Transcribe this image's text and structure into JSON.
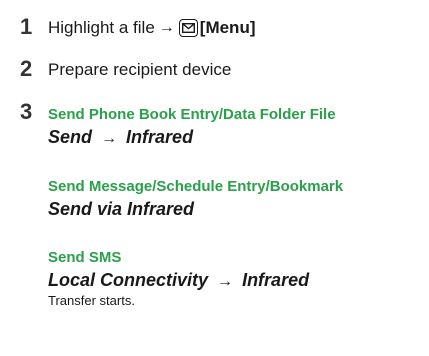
{
  "steps": [
    {
      "number": "1",
      "text": "Highlight a file",
      "arrow": "→",
      "menu_label": "[Menu]",
      "menu_icon": "envelope-icon"
    },
    {
      "number": "2",
      "text": "Prepare recipient device"
    },
    {
      "number": "3"
    }
  ],
  "options": [
    {
      "heading": "Send Phone Book Entry/Data Folder File",
      "action_a": "Send",
      "arrow": "→",
      "action_b": "Infrared"
    },
    {
      "heading": "Send Message/Schedule Entry/Bookmark",
      "action_a": "Send via Infrared"
    },
    {
      "heading": "Send SMS",
      "action_a": "Local Connectivity",
      "arrow": "→",
      "action_b": "Infrared"
    }
  ],
  "result": "Transfer starts.",
  "colors": {
    "heading": "#2aa04a",
    "text": "#1a1a1a"
  }
}
